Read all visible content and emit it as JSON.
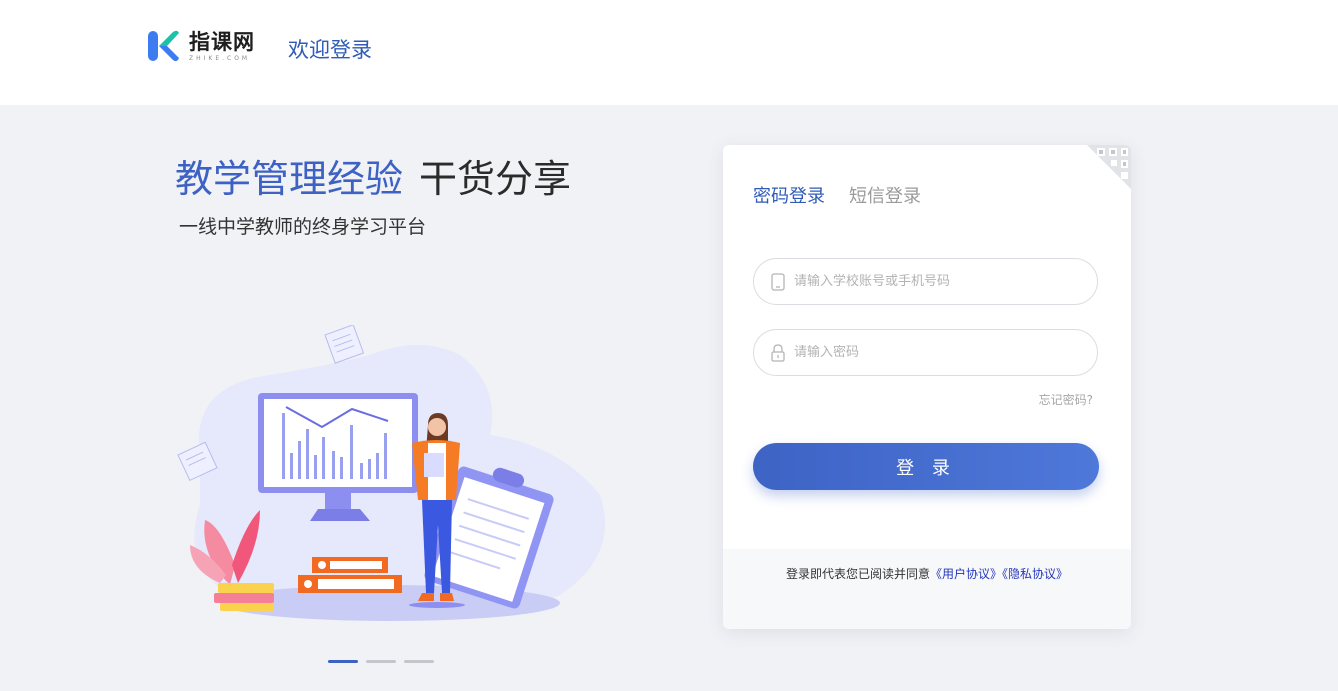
{
  "header": {
    "logo_cn": "指课网",
    "logo_en": "ZHIKE.COM",
    "welcome": "欢迎登录"
  },
  "hero": {
    "title_blue": "教学管理经验",
    "title_dark": "干货分享",
    "subtitle": "一线中学教师的终身学习平台"
  },
  "carousel": {
    "total": 3,
    "active_index": 0
  },
  "login": {
    "tabs": [
      {
        "label": "密码登录",
        "active": true
      },
      {
        "label": "短信登录",
        "active": false
      }
    ],
    "account_placeholder": "请输入学校账号或手机号码",
    "account_value": "",
    "password_placeholder": "请输入密码",
    "password_value": "",
    "forgot": "忘记密码?",
    "submit": "登 录",
    "agreement_prefix": "登录即代表您已阅读并同意",
    "user_agreement": "《用户协议》",
    "privacy_agreement": "《隐私协议》"
  },
  "icons": {
    "logo": "logo-k-icon",
    "phone": "phone-icon",
    "lock": "lock-icon",
    "qr": "qr-code-icon"
  },
  "colors": {
    "accent": "#3d62c4",
    "background": "#f1f2f6",
    "link": "#2637b8"
  }
}
